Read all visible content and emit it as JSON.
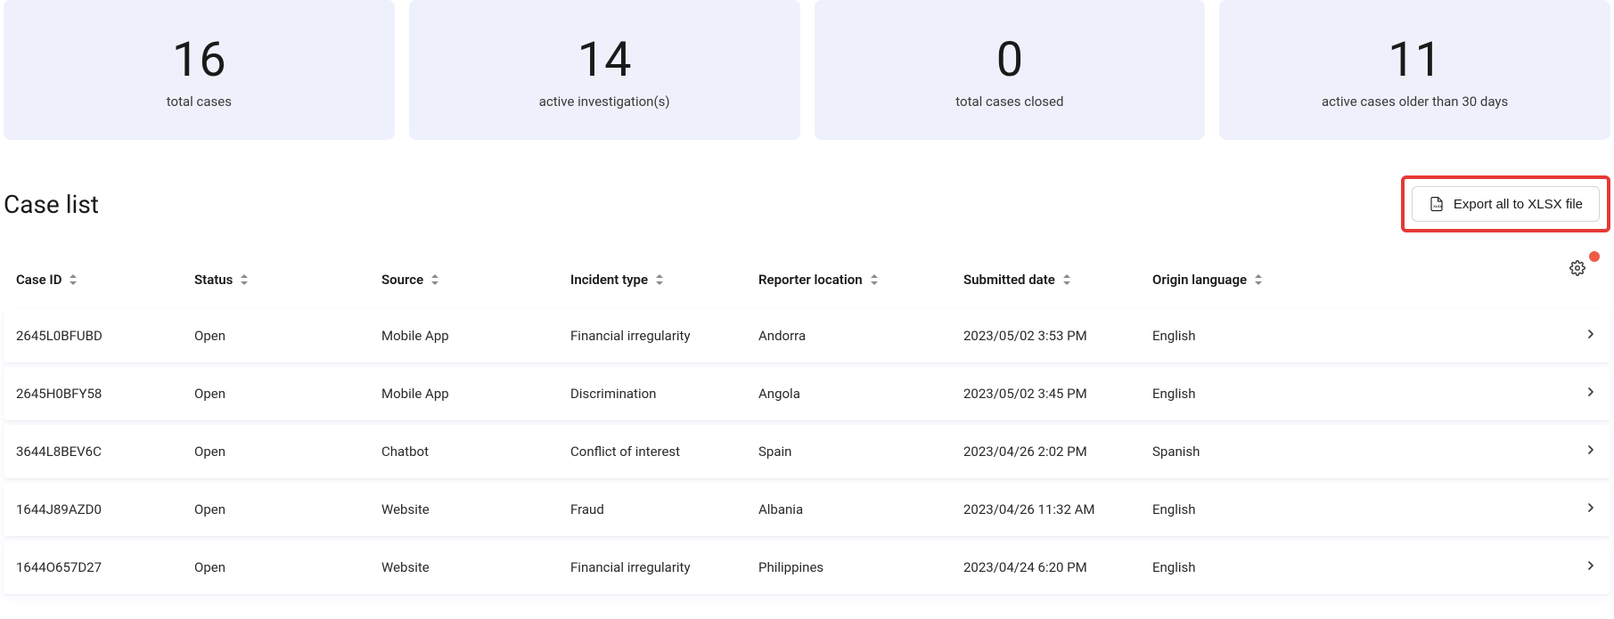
{
  "stats": [
    {
      "value": "16",
      "label": "total cases"
    },
    {
      "value": "14",
      "label": "active investigation(s)"
    },
    {
      "value": "0",
      "label": "total cases closed"
    },
    {
      "value": "11",
      "label": "active cases older than 30 days"
    }
  ],
  "list": {
    "title": "Case list",
    "export_label": "Export all to XLSX file"
  },
  "columns": {
    "case_id": "Case ID",
    "status": "Status",
    "source": "Source",
    "incident_type": "Incident type",
    "reporter_location": "Reporter location",
    "submitted_date": "Submitted date",
    "origin_language": "Origin language"
  },
  "rows": [
    {
      "case_id": "2645L0BFUBD",
      "status": "Open",
      "source": "Mobile App",
      "incident_type": "Financial irregularity",
      "reporter_location": "Andorra",
      "submitted_date": "2023/05/02 3:53 PM",
      "origin_language": "English"
    },
    {
      "case_id": "2645H0BFY58",
      "status": "Open",
      "source": "Mobile App",
      "incident_type": "Discrimination",
      "reporter_location": "Angola",
      "submitted_date": "2023/05/02 3:45 PM",
      "origin_language": "English"
    },
    {
      "case_id": "3644L8BEV6C",
      "status": "Open",
      "source": "Chatbot",
      "incident_type": "Conflict of interest",
      "reporter_location": "Spain",
      "submitted_date": "2023/04/26 2:02 PM",
      "origin_language": "Spanish"
    },
    {
      "case_id": "1644J89AZD0",
      "status": "Open",
      "source": "Website",
      "incident_type": "Fraud",
      "reporter_location": "Albania",
      "submitted_date": "2023/04/26 11:32 AM",
      "origin_language": "English"
    },
    {
      "case_id": "1644O657D27",
      "status": "Open",
      "source": "Website",
      "incident_type": "Financial irregularity",
      "reporter_location": "Philippines",
      "submitted_date": "2023/04/24 6:20 PM",
      "origin_language": "English"
    }
  ]
}
